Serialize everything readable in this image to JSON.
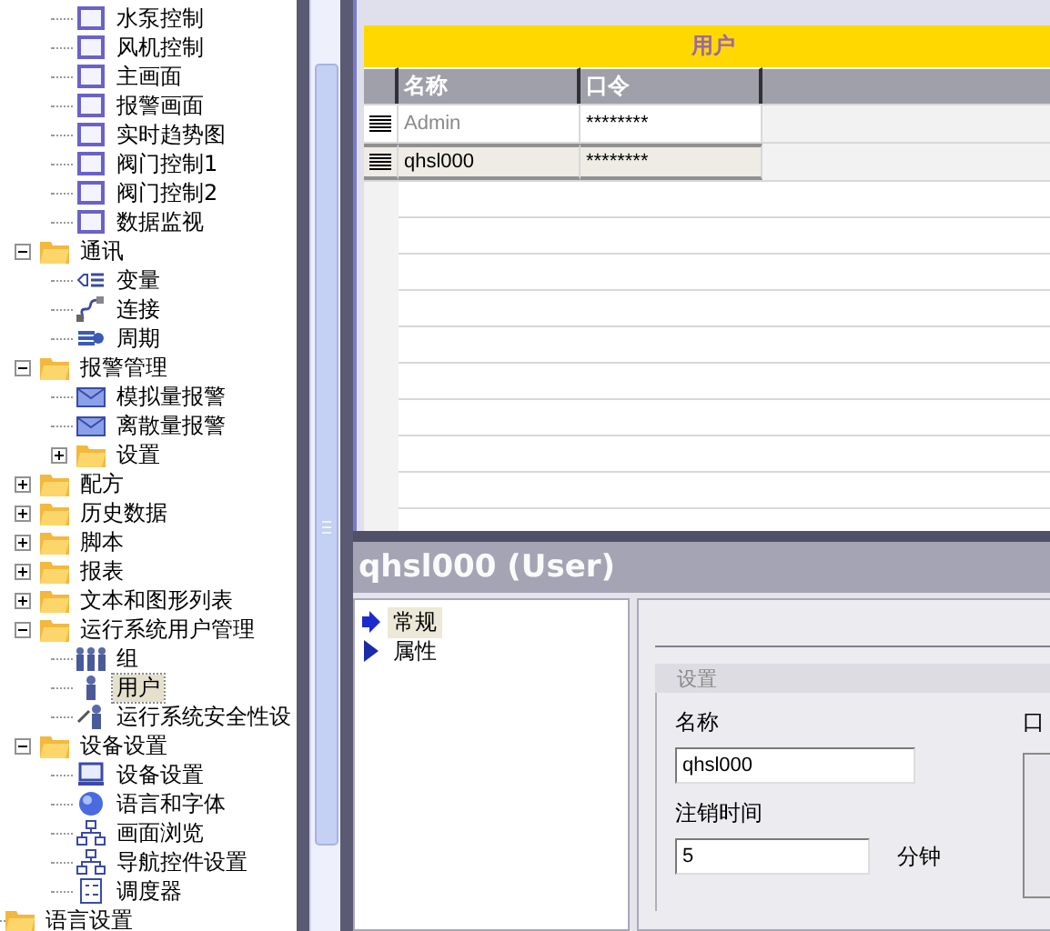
{
  "tree": {
    "items": [
      {
        "children": [
          {
            "children": [
              {
                "label": "水泵控制",
                "kind": "screen",
                "selected": false
              },
              {
                "label": "风机控制",
                "kind": "screen",
                "selected": false
              },
              {
                "label": "主画面",
                "kind": "screen",
                "selected": false
              },
              {
                "label": "报警画面",
                "kind": "screen",
                "selected": false
              },
              {
                "label": "实时趋势图",
                "kind": "screen",
                "selected": false
              },
              {
                "label": "阀门控制1",
                "kind": "screen",
                "selected": false
              },
              {
                "label": "阀门控制2",
                "kind": "screen",
                "selected": false
              },
              {
                "label": "数据监视",
                "kind": "screen",
                "selected": false
              }
            ]
          },
          {
            "label": "通讯",
            "expanded": true,
            "selected": false,
            "children": [
              {
                "label": "变量",
                "kind": "tag",
                "selected": false
              },
              {
                "label": "连接",
                "kind": "connection",
                "selected": false
              },
              {
                "label": "周期",
                "kind": "cycle",
                "selected": false
              }
            ]
          },
          {
            "label": "报警管理",
            "expanded": true,
            "selected": false,
            "children": [
              {
                "label": "模拟量报警",
                "kind": "alarm",
                "selected": false
              },
              {
                "label": "离散量报警",
                "kind": "alarm",
                "selected": false
              },
              {
                "label": "设置",
                "expanded": false,
                "selected": false
              }
            ]
          },
          {
            "label": "配方",
            "expanded": false,
            "selected": false
          },
          {
            "label": "历史数据",
            "expanded": false,
            "selected": false
          },
          {
            "label": "脚本",
            "expanded": false,
            "selected": false
          },
          {
            "label": "报表",
            "expanded": false,
            "selected": false
          },
          {
            "label": "文本和图形列表",
            "expanded": false,
            "selected": false
          },
          {
            "label": "运行系统用户管理",
            "expanded": true,
            "selected": false,
            "children": [
              {
                "label": "组",
                "kind": "group",
                "selected": false
              },
              {
                "label": "用户",
                "kind": "user",
                "selected": true
              },
              {
                "label": "运行系统安全性设",
                "kind": "security",
                "selected": false
              }
            ]
          },
          {
            "label": "设备设置",
            "expanded": true,
            "selected": false,
            "children": [
              {
                "label": "设备设置",
                "kind": "device",
                "selected": false
              },
              {
                "label": "语言和字体",
                "kind": "globe",
                "selected": false
              },
              {
                "label": "画面浏览",
                "kind": "hierarchy",
                "selected": false
              },
              {
                "label": "导航控件设置",
                "kind": "hierarchy",
                "selected": false
              },
              {
                "label": "调度器",
                "kind": "list",
                "selected": false
              }
            ]
          }
        ]
      },
      {
        "label": "语言设置",
        "selected": false
      }
    ]
  },
  "table": {
    "title": "用户",
    "columns": [
      "名称",
      "口令"
    ],
    "rows": [
      {
        "name": "Admin",
        "password": "********",
        "greyed": true,
        "selected": false
      },
      {
        "name": "qhsl000",
        "password": "********",
        "greyed": false,
        "selected": true
      }
    ]
  },
  "properties": {
    "title": "qhsl000 (User)",
    "nav": [
      {
        "label": "常规",
        "selected": true
      },
      {
        "label": "属性",
        "selected": false
      }
    ],
    "group": {
      "title": "设置",
      "name_label": "名称",
      "name_value": "qhsl000",
      "logoff_label": "注销时间",
      "logoff_value": "5",
      "logoff_unit": "分钟",
      "column_3_label": "口"
    }
  }
}
